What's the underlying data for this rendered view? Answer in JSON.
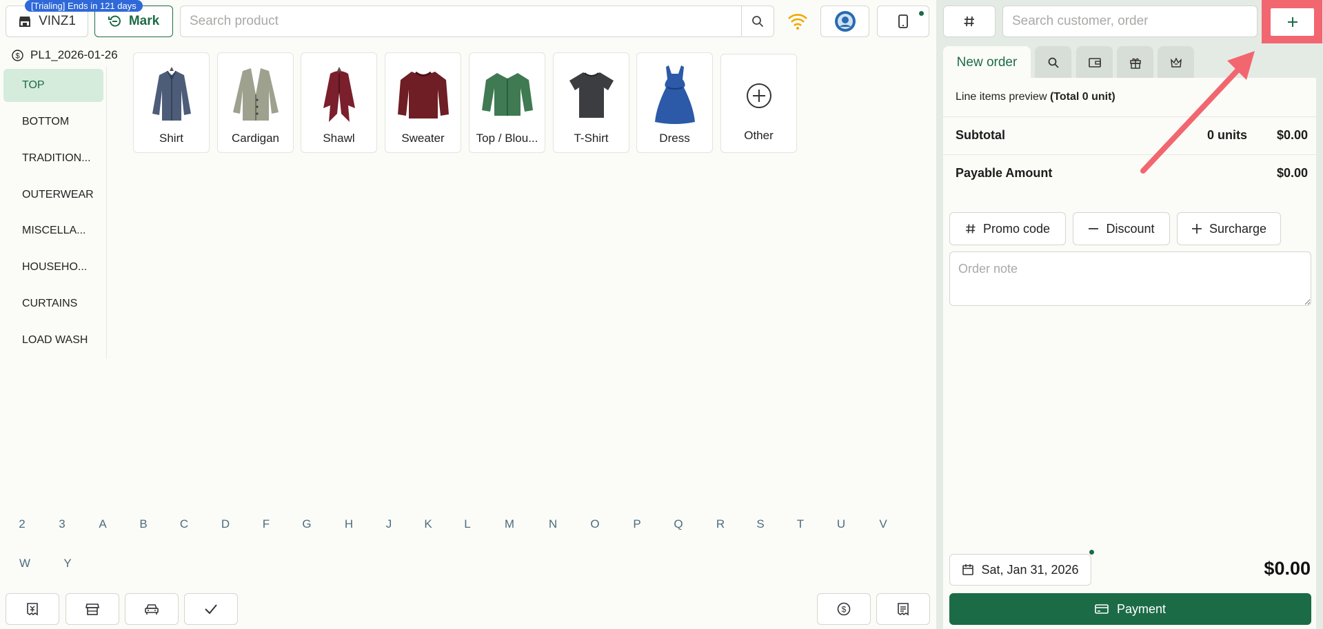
{
  "header": {
    "trial_badge": "[Trialing] Ends in 121 days",
    "store_label": "VINZ1",
    "mark_label": "Mark",
    "search_placeholder": "Search product"
  },
  "price_list": "PL1_2026-01-26",
  "categories": [
    {
      "label": "TOP",
      "active": true
    },
    {
      "label": "BOTTOM"
    },
    {
      "label": "TRADITION..."
    },
    {
      "label": "OUTERWEAR"
    },
    {
      "label": "MISCELLA..."
    },
    {
      "label": "HOUSEHO..."
    },
    {
      "label": "CURTAINS"
    },
    {
      "label": "LOAD WASH"
    }
  ],
  "products": [
    {
      "label": "Shirt",
      "icon": "shirt-image"
    },
    {
      "label": "Cardigan",
      "icon": "cardigan-image"
    },
    {
      "label": "Shawl",
      "icon": "shawl-image"
    },
    {
      "label": "Sweater",
      "icon": "sweater-image"
    },
    {
      "label": "Top / Blou...",
      "icon": "blouse-image"
    },
    {
      "label": "T-Shirt",
      "icon": "tshirt-image"
    },
    {
      "label": "Dress",
      "icon": "dress-image"
    },
    {
      "label": "Other",
      "icon": "plus-circle-icon"
    }
  ],
  "letters_row1": [
    "2",
    "3",
    "A",
    "B",
    "C",
    "D",
    "F",
    "G",
    "H",
    "J",
    "K",
    "L",
    "M",
    "N",
    "O",
    "P",
    "Q",
    "R",
    "S",
    "T",
    "U",
    "V"
  ],
  "letters_row2": [
    "W",
    "Y"
  ],
  "right": {
    "customer_search_placeholder": "Search customer, order",
    "tab_new_order": "New order",
    "line_items_prefix": "Line items preview ",
    "line_items_total": "(Total 0 unit)",
    "subtotal_label": "Subtotal",
    "subtotal_units": "0 units",
    "subtotal_amount": "$0.00",
    "payable_label": "Payable Amount",
    "payable_amount": "$0.00",
    "promo_label": "Promo code",
    "discount_label": "Discount",
    "surcharge_label": "Surcharge",
    "order_note_placeholder": "Order note",
    "date_label": "Sat, Jan 31, 2026",
    "total": "$0.00",
    "payment_label": "Payment"
  },
  "colors": {
    "primary": "#1c6b47",
    "trial_badge": "#2f68d8",
    "highlight": "#f26670",
    "wifi": "#f2a800"
  }
}
